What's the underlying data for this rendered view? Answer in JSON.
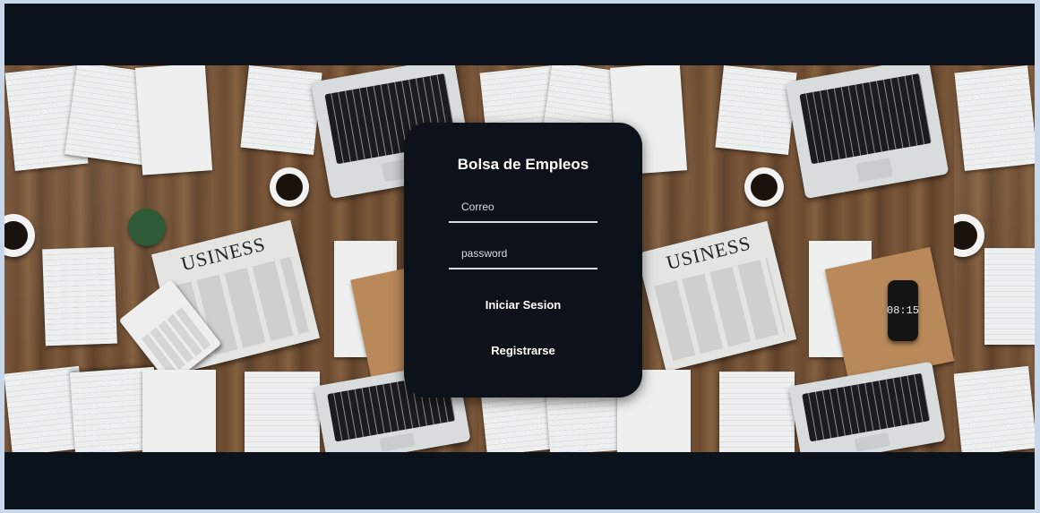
{
  "login": {
    "title": "Bolsa de Empleos",
    "email_placeholder": "Correo",
    "password_placeholder": "password",
    "login_button": "Iniciar Sesion",
    "register_button": "Registrarse"
  },
  "background": {
    "newspaper_headline": "USINESS",
    "phone_time": "08:15"
  },
  "colors": {
    "page_background": "#0b121c",
    "card_background": "#0c111a",
    "outer_border": "#c9d7ea",
    "text": "#ffffff"
  }
}
